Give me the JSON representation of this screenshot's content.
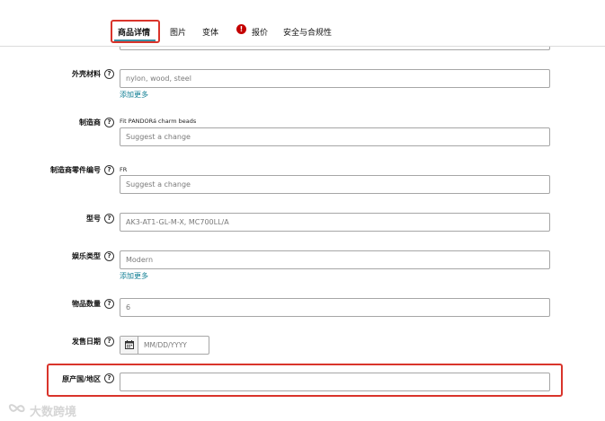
{
  "tabs": [
    {
      "label": "商品详情",
      "active": true
    },
    {
      "label": "图片"
    },
    {
      "label": "变体"
    },
    {
      "label": "报价",
      "warning": true
    },
    {
      "label": "安全与合规性"
    }
  ],
  "warning_glyph": "!",
  "help_glyph": "?",
  "fields": {
    "shell_material": {
      "label": "外壳材料",
      "placeholder": "nylon, wood, steel",
      "add_more": "添加更多"
    },
    "manufacturer": {
      "label": "制造商",
      "current_value": "Fit PANDORá charm beads",
      "placeholder": "Suggest a change"
    },
    "part_number": {
      "label": "制造商零件编号",
      "current_value": "FR",
      "placeholder": "Suggest a change"
    },
    "model": {
      "label": "型号",
      "placeholder": "AK3-AT1-GL-M-X, MC700LL/A"
    },
    "entertainment_type": {
      "label": "娱乐类型",
      "placeholder": "Modern",
      "add_more": "添加更多"
    },
    "quantity": {
      "label": "物品数量",
      "placeholder": "6"
    },
    "release_date": {
      "label": "发售日期",
      "placeholder": "MM/DD/YYYY"
    },
    "country_of_origin": {
      "label": "原产国/地区",
      "placeholder": ""
    }
  },
  "watermark": {
    "text": "大数跨境"
  },
  "colors": {
    "highlight": "#d9342b",
    "tab_underline": "#3a8fa3",
    "link": "#0f7e93",
    "warning": "#c40000",
    "border": "#a6a6a6"
  },
  "icons": {
    "help": "help-circle-icon",
    "warning": "warning-icon",
    "calendar": "calendar-icon",
    "watermark": "watermark-logo-icon"
  }
}
